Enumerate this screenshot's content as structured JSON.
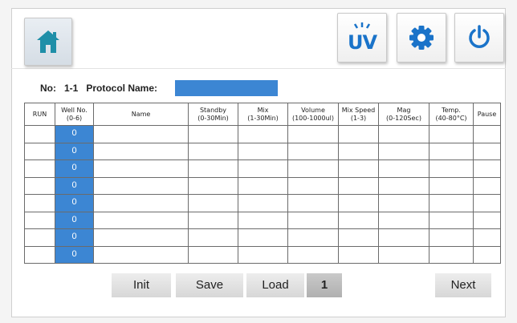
{
  "protocol": {
    "no_label": "No:",
    "no_value": "1-1",
    "name_label": "Protocol Name:",
    "name_value": ""
  },
  "table": {
    "headers": [
      {
        "line1": "RUN",
        "line2": ""
      },
      {
        "line1": "Well No.",
        "line2": "(0-6)"
      },
      {
        "line1": "Name",
        "line2": ""
      },
      {
        "line1": "Standby",
        "line2": "(0-30Min)"
      },
      {
        "line1": "Mix",
        "line2": "(1-30Min)"
      },
      {
        "line1": "Volume",
        "line2": "(100-1000ul)"
      },
      {
        "line1": "Mix Speed",
        "line2": "(1-3)"
      },
      {
        "line1": "Mag",
        "line2": "(0-120Sec)"
      },
      {
        "line1": "Temp.",
        "line2": "(40-80°C)"
      },
      {
        "line1": "Pause",
        "line2": ""
      }
    ],
    "rows": [
      {
        "well": "0"
      },
      {
        "well": "0"
      },
      {
        "well": "0"
      },
      {
        "well": "0"
      },
      {
        "well": "0"
      },
      {
        "well": "0"
      },
      {
        "well": "0"
      },
      {
        "well": "0"
      }
    ]
  },
  "footer": {
    "init_label": "Init",
    "save_label": "Save",
    "load_label": "Load",
    "page_number": "1",
    "next_label": "Next"
  },
  "toolbar": {
    "uv_label": "UV"
  },
  "icons": {
    "home": "home-icon",
    "uv": "uv-icon",
    "settings": "gear-icon",
    "power": "power-icon"
  },
  "colors": {
    "accent": "#3c86d3",
    "icon_blue": "#1a73c9",
    "home_icon": "#1f8fa8"
  }
}
